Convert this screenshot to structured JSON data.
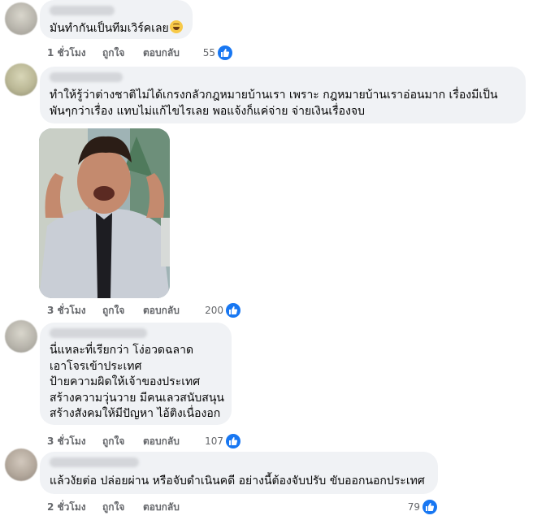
{
  "comments": [
    {
      "text": "มันทำกันเป็นทีมเวิร์คเลย",
      "emoji": "grinning-squinting-face",
      "time": "1 ชั่วโมง",
      "like_label": "ถูกใจ",
      "reply_label": "ตอบกลับ",
      "likes": "55"
    },
    {
      "text": "ทำให้รู้ว่าต่างชาติไม่ได้เกรงกลัวกฎหมายบ้านเรา เพราะ กฎหมายบ้านเราอ่อนมาก เรื่องมีเป็น\nพันๆกว่าเรื่อง แทบไม่แก้ไขไรเลย พอแจ้งก็แค่จ่าย จ่ายเงินเรื่องจบ",
      "attachment": "laughing-man-gif",
      "time": "3 ชั่วโมง",
      "like_label": "ถูกใจ",
      "reply_label": "ตอบกลับ",
      "likes": "200"
    },
    {
      "text": "นี่แหละที่เรียกว่า โง่อวดฉลาด\nเอาโจรเข้าประเทศ\nป้ายความผิดให้เจ้าของประเทศ\nสร้างความวุ่นวาย มีคนเลวสนับสนุน\nสร้างสังคมให้มีปัญหา ไอ้ติงเนื่องอก",
      "time": "3 ชั่วโมง",
      "like_label": "ถูกใจ",
      "reply_label": "ตอบกลับ",
      "likes": "107"
    },
    {
      "text": "แล้วงัยต่อ ปล่อยผ่าน หรือจับดำเนินคดี อย่างนี้ต้องจับปรับ ขับออกนอกประเทศ",
      "time": "2 ชั่วโมง",
      "like_label": "ถูกใจ",
      "reply_label": "ตอบกลับ",
      "likes": "79"
    }
  ],
  "colors": {
    "bubble": "#f0f2f5",
    "meta_text": "#65676b",
    "like_blue": "#1877f2"
  }
}
